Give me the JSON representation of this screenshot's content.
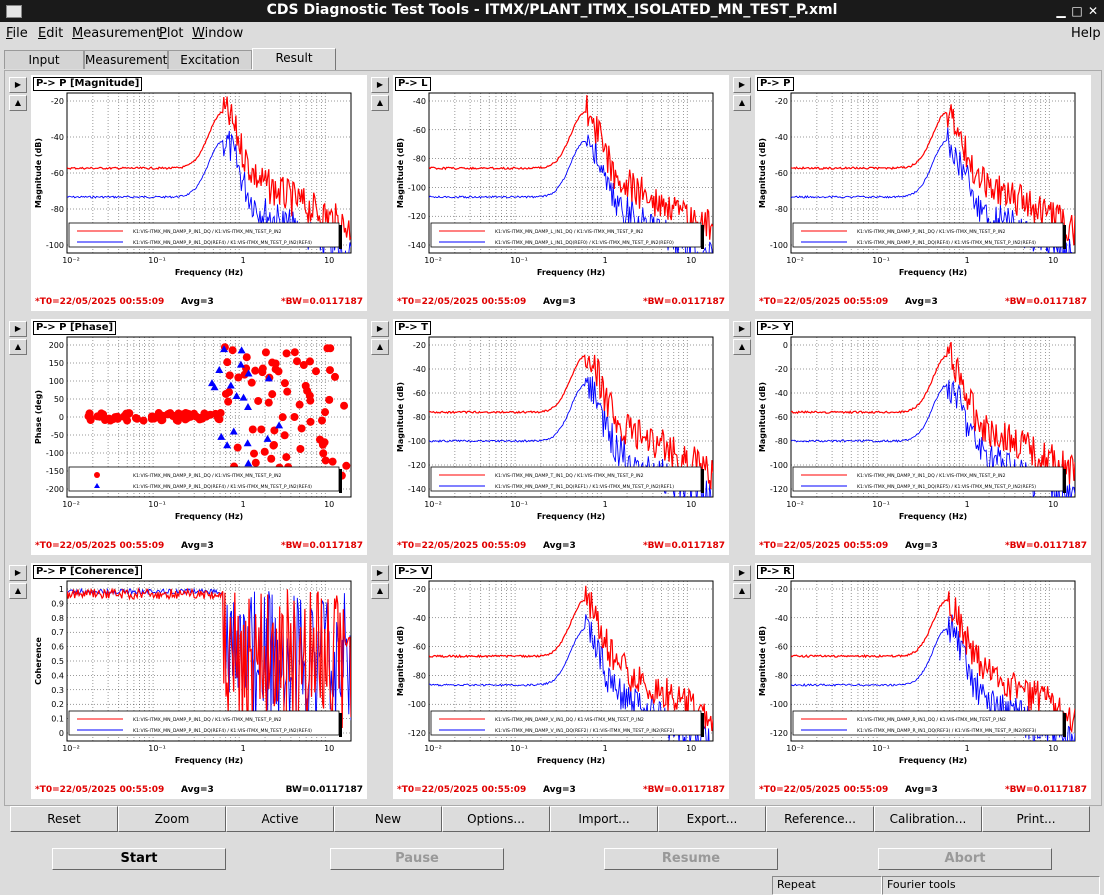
{
  "window": {
    "title": "CDS Diagnostic Test Tools - ITMX/PLANT_ITMX_ISOLATED_MN_TEST_P.xml"
  },
  "menu": [
    {
      "label": "File",
      "key": "F"
    },
    {
      "label": "Edit",
      "key": "E"
    },
    {
      "label": "Measurement",
      "key": "M"
    },
    {
      "label": "Plot",
      "key": "P"
    },
    {
      "label": "Window",
      "key": "W"
    }
  ],
  "help": "Help",
  "tabs": [
    "Input",
    "Measurement",
    "Excitation",
    "Result"
  ],
  "active_tab": "Result",
  "colors": {
    "series1": "#ff0000",
    "series2": "#0000ff",
    "stamp": "#e00000"
  },
  "plots": [
    {
      "title": "P-> P [Magnitude]",
      "xlabel": "Frequency (Hz)",
      "ylabel": "Magnitude (dB)",
      "yticks": [
        "-20",
        "-40",
        "-60",
        "-80",
        "-100"
      ],
      "legend": [
        "K1:VIS-ITMX_MN_DAMP_P_IN1_DQ / K1:VIS-ITMX_MN_TEST_P_IN2",
        "K1:VIS-ITMX_MN_DAMP_P_IN1_DQ(REF4) / K1:VIS-ITMX_MN_TEST_P_IN2(REF4)"
      ],
      "t0": "*T0=22/05/2025 00:55:09",
      "avg": "Avg=3",
      "bw": "*BW=0.0117187"
    },
    {
      "title": "P-> L",
      "xlabel": "Frequency (Hz)",
      "ylabel": "Magnitude (dB)",
      "yticks": [
        "-40",
        "-60",
        "-80",
        "-100",
        "-120",
        "-140"
      ],
      "legend": [
        "K1:VIS-ITMX_MN_DAMP_L_IN1_DQ / K1:VIS-ITMX_MN_TEST_P_IN2",
        "K1:VIS-ITMX_MN_DAMP_L_IN1_DQ(REF0) / K1:VIS-ITMX_MN_TEST_P_IN2(REF0)"
      ],
      "t0": "*T0=22/05/2025 00:55:09",
      "avg": "Avg=3",
      "bw": "*BW=0.0117187"
    },
    {
      "title": "P-> P",
      "xlabel": "Frequency (Hz)",
      "ylabel": "Magnitude (dB)",
      "yticks": [
        "-20",
        "-40",
        "-60",
        "-80",
        "-100"
      ],
      "legend": [
        "K1:VIS-ITMX_MN_DAMP_P_IN1_DQ / K1:VIS-ITMX_MN_TEST_P_IN2",
        "K1:VIS-ITMX_MN_DAMP_P_IN1_DQ(REF4) / K1:VIS-ITMX_MN_TEST_P_IN2(REF4)"
      ],
      "t0": "*T0=22/05/2025 00:55:09",
      "avg": "Avg=3",
      "bw": "*BW=0.0117187"
    },
    {
      "title": "P-> P [Phase]",
      "xlabel": "Frequency (Hz)",
      "ylabel": "Phase (deg)",
      "yticks": [
        "200",
        "150",
        "100",
        "50",
        "0",
        "-50",
        "-100",
        "-150",
        "-200"
      ],
      "legend": [
        "K1:VIS-ITMX_MN_DAMP_P_IN1_DQ / K1:VIS-ITMX_MN_TEST_P_IN2",
        "K1:VIS-ITMX_MN_DAMP_P_IN1_DQ(REF4) / K1:VIS-ITMX_MN_TEST_P_IN2(REF4)"
      ],
      "t0": "*T0=22/05/2025 00:55:09",
      "avg": "Avg=3",
      "bw": "*BW=0.0117187"
    },
    {
      "title": "P-> T",
      "xlabel": "Frequency (Hz)",
      "ylabel": "Magnitude (dB)",
      "yticks": [
        "-20",
        "-40",
        "-60",
        "-80",
        "-100",
        "-120",
        "-140"
      ],
      "legend": [
        "K1:VIS-ITMX_MN_DAMP_T_IN1_DQ / K1:VIS-ITMX_MN_TEST_P_IN2",
        "K1:VIS-ITMX_MN_DAMP_T_IN1_DQ(REF1) / K1:VIS-ITMX_MN_TEST_P_IN2(REF1)"
      ],
      "t0": "*T0=22/05/2025 00:55:09",
      "avg": "Avg=3",
      "bw": "*BW=0.0117187"
    },
    {
      "title": "P-> Y",
      "xlabel": "Frequency (Hz)",
      "ylabel": "Magnitude (dB)",
      "yticks": [
        "0",
        "-20",
        "-40",
        "-60",
        "-80",
        "-100",
        "-120"
      ],
      "legend": [
        "K1:VIS-ITMX_MN_DAMP_Y_IN1_DQ / K1:VIS-ITMX_MN_TEST_P_IN2",
        "K1:VIS-ITMX_MN_DAMP_Y_IN1_DQ(REF5) / K1:VIS-ITMX_MN_TEST_P_IN2(REF5)"
      ],
      "t0": "*T0=22/05/2025 00:55:09",
      "avg": "Avg=3",
      "bw": "*BW=0.0117187"
    },
    {
      "title": "P-> P [Coherence]",
      "xlabel": "Frequency (Hz)",
      "ylabel": "Coherence",
      "yticks": [
        "1",
        "0.9",
        "0.8",
        "0.7",
        "0.6",
        "0.5",
        "0.4",
        "0.3",
        "0.2",
        "0.1",
        "0"
      ],
      "legend": [
        "K1:VIS-ITMX_MN_DAMP_P_IN1_DQ / K1:VIS-ITMX_MN_TEST_P_IN2",
        "K1:VIS-ITMX_MN_DAMP_P_IN1_DQ(REF4) / K1:VIS-ITMX_MN_TEST_P_IN2(REF4)"
      ],
      "t0": "*T0=22/05/2025 00:55:09",
      "avg": "Avg=3",
      "bw": "BW=0.0117187"
    },
    {
      "title": "P-> V",
      "xlabel": "Frequency (Hz)",
      "ylabel": "Magnitude (dB)",
      "yticks": [
        "-20",
        "-40",
        "-60",
        "-80",
        "-100",
        "-120"
      ],
      "legend": [
        "K1:VIS-ITMX_MN_DAMP_V_IN1_DQ / K1:VIS-ITMX_MN_TEST_P_IN2",
        "K1:VIS-ITMX_MN_DAMP_V_IN1_DQ(REF2) / K1:VIS-ITMX_MN_TEST_P_IN2(REF2)"
      ],
      "t0": "*T0=22/05/2025 00:55:09",
      "avg": "Avg=3",
      "bw": "*BW=0.0117187"
    },
    {
      "title": "P-> R",
      "xlabel": "Frequency (Hz)",
      "ylabel": "Magnitude (dB)",
      "yticks": [
        "-20",
        "-40",
        "-60",
        "-80",
        "-100",
        "-120"
      ],
      "legend": [
        "K1:VIS-ITMX_MN_DAMP_R_IN1_DQ / K1:VIS-ITMX_MN_TEST_P_IN2",
        "K1:VIS-ITMX_MN_DAMP_R_IN1_DQ(REF3) / K1:VIS-ITMX_MN_TEST_P_IN2(REF3)"
      ],
      "t0": "*T0=22/05/2025 00:55:09",
      "avg": "Avg=3",
      "bw": "*BW=0.0117187"
    }
  ],
  "xticks": [
    "10⁻²",
    "10⁻¹",
    "1",
    "10"
  ],
  "plot_buttons": [
    "Reset",
    "Zoom",
    "Active",
    "New",
    "Options...",
    "Import...",
    "Export...",
    "Reference...",
    "Calibration...",
    "Print..."
  ],
  "controls": [
    {
      "label": "Start",
      "enabled": true
    },
    {
      "label": "Pause",
      "enabled": false
    },
    {
      "label": "Resume",
      "enabled": false
    },
    {
      "label": "Abort",
      "enabled": false
    }
  ],
  "status": [
    "Repeat",
    "Fourier tools"
  ]
}
